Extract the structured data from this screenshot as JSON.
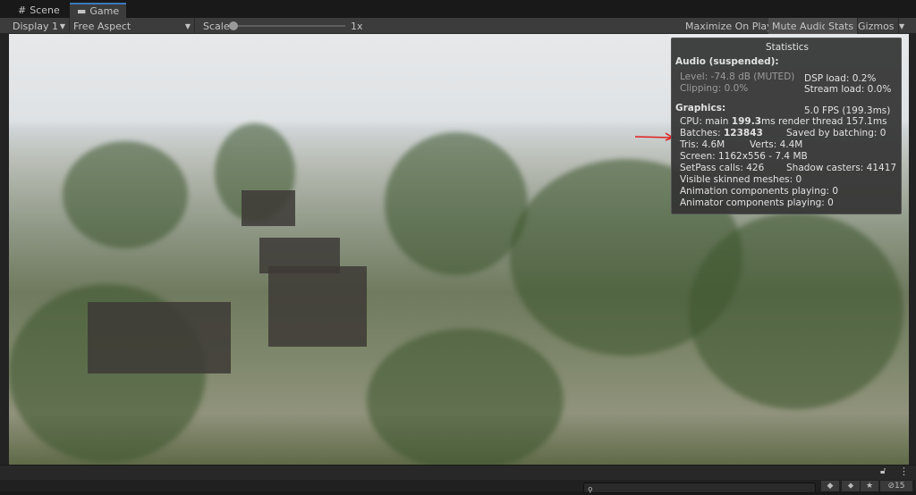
{
  "tabs": [
    {
      "label": "Scene",
      "icon": "grid-icon"
    },
    {
      "label": "Game",
      "icon": "gamepad-icon",
      "active": true
    }
  ],
  "toolbar": {
    "display": "Display 1",
    "aspect": "Free Aspect",
    "scale_label": "Scale",
    "scale_value": "1x",
    "scale_fraction": 0.0,
    "maximize": "Maximize On Play",
    "mute": "Mute Audio",
    "stats": "Stats",
    "gizmos": "Gizmos"
  },
  "stats": {
    "title": "Statistics",
    "audio_header": "Audio (suspended):",
    "level": "Level: -74.8 dB (MUTED)",
    "clipping": "Clipping: 0.0%",
    "dsp": "DSP load: 0.2%",
    "stream": "Stream load: 0.0%",
    "graphics_header": "Graphics:",
    "fps": "5.0 FPS (199.3ms)",
    "cpu_label": "CPU: main ",
    "cpu_main": "199.3",
    "cpu_rest": "ms  render thread 157.1ms",
    "batches_label": "Batches: ",
    "batches": "123843",
    "saved": "Saved by batching: 0",
    "tris": "Tris: 4.6M",
    "verts": "Verts: 4.4M",
    "screen": "Screen: 1162x556 - 7.4 MB",
    "setpass": "SetPass calls: 426",
    "shadow": "Shadow casters: 41417",
    "skinned": "Visible skinned meshes: 0",
    "animation": "Animation components playing: 0",
    "animator": "Animator components playing: 0"
  },
  "bottom": {
    "hidden_count": "15"
  },
  "colors": {
    "accent": "#3a79bb",
    "annotation": "#e02020"
  }
}
